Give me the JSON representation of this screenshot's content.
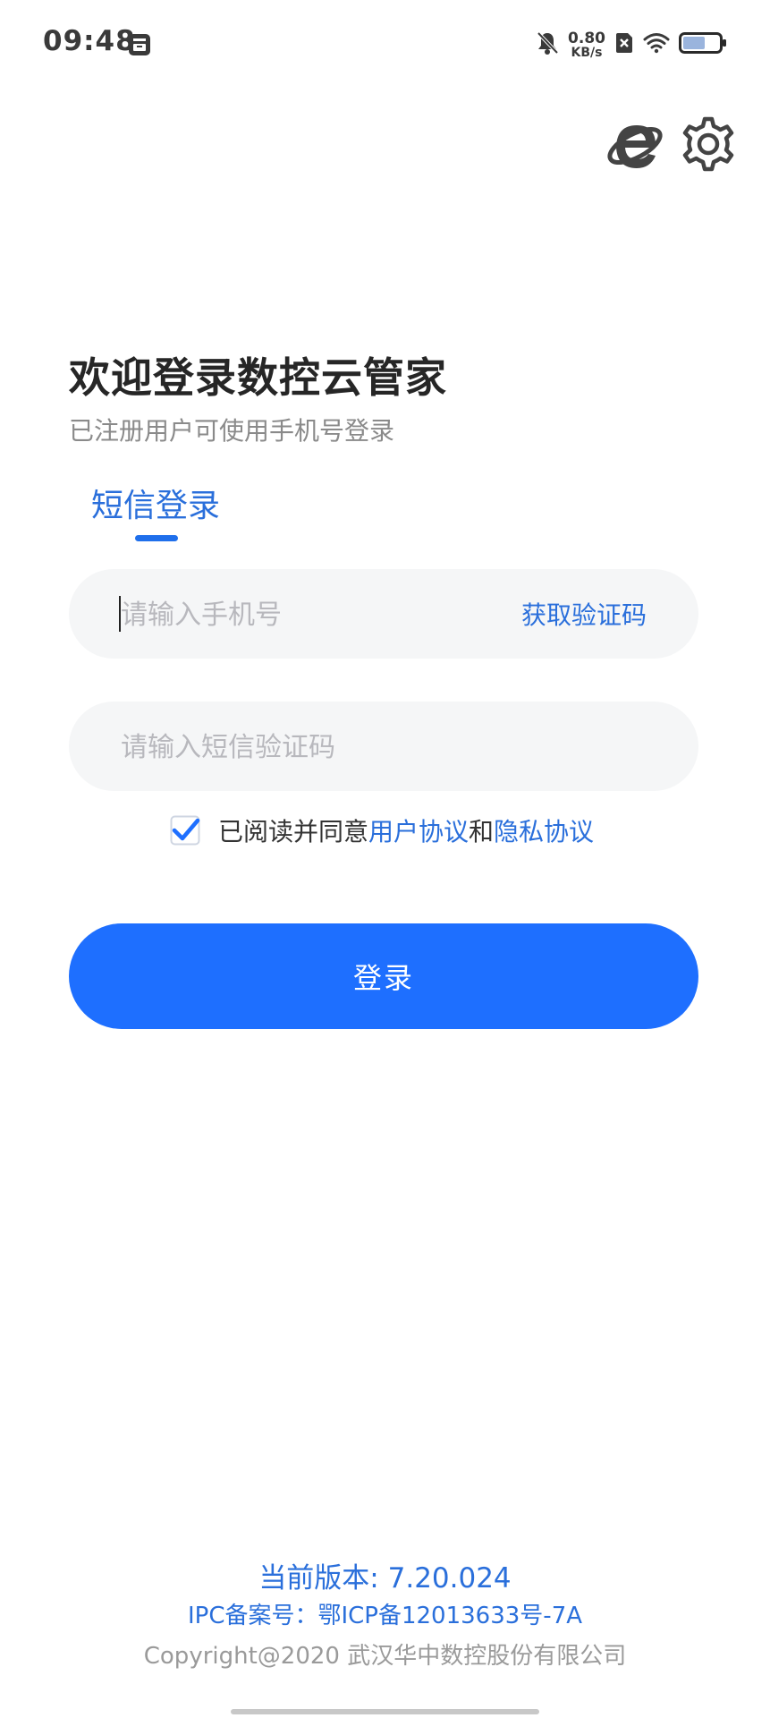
{
  "status_bar": {
    "time": "09:48",
    "net_speed_value": "0.80",
    "net_speed_unit": "KB/s",
    "icons": [
      "app-notification-icon",
      "mute-bell-icon",
      "sim-x-icon",
      "wifi-icon",
      "battery-icon"
    ]
  },
  "top_actions": {
    "icons": [
      "browser-e-icon",
      "gear-icon"
    ]
  },
  "header": {
    "title": "欢迎登录数控云管家",
    "subtitle": "已注册用户可使用手机号登录"
  },
  "tabs": [
    {
      "label": "短信登录",
      "active": true
    }
  ],
  "form": {
    "phone_placeholder": "请输入手机号",
    "get_code_label": "获取验证码",
    "code_placeholder": "请输入短信验证码"
  },
  "agreement": {
    "checked": true,
    "prefix": "已阅读并同意",
    "user_agreement": "用户协议",
    "conjunction": "和",
    "privacy_agreement": "隐私协议"
  },
  "login_button": {
    "label": "登录"
  },
  "footer": {
    "version": "当前版本: 7.20.024",
    "icp": "IPC备案号：鄂ICP备12013633号-7A",
    "copyright": "Copyright@2020 武汉华中数控股份有限公司"
  },
  "colors": {
    "accent": "#1e6fff",
    "link": "#2a6fdb",
    "input_bg": "#f5f6f7",
    "placeholder": "#b8b8bd"
  }
}
